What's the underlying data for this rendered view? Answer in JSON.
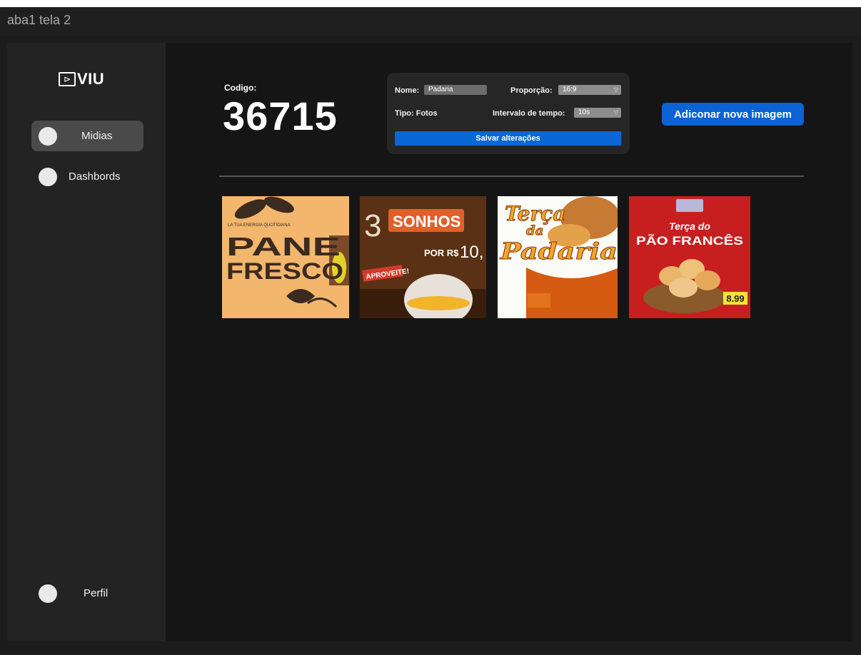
{
  "window": {
    "title": "aba1 tela 2"
  },
  "logo": {
    "glyph": "⊳",
    "text": "VIU"
  },
  "sidebar": {
    "items": [
      {
        "label": "Midias",
        "active": true
      },
      {
        "label": "Dashbords",
        "active": false
      }
    ],
    "profile": {
      "label": "Perfil"
    }
  },
  "main": {
    "code_label": "Codigo:",
    "code_value": "36715",
    "add_button": "Adiconar nova imagem"
  },
  "settings": {
    "name_label": "Nome:",
    "name_value": "Padaria",
    "ratio_label": "Proporção:",
    "ratio_value": "16:9",
    "type_label": "Tipo: Fotos",
    "interval_label": "Intervalo de tempo:",
    "interval_value": "10s",
    "save_button": "Salvar alterações"
  },
  "media": [
    {
      "lines": [
        "LA TUA ENERGIA QUOTIDIANA",
        "PANE",
        "FRESCO"
      ]
    },
    {
      "lines": [
        "3",
        "SONHOS",
        "POR R$",
        "10,",
        "APROVEITE!"
      ]
    },
    {
      "lines": [
        "Terça",
        "da",
        "Padaria"
      ]
    },
    {
      "lines": [
        "Terça do",
        "PÃO FRANCÊS",
        "8.99"
      ]
    }
  ],
  "colors": {
    "accent": "#0b63d4",
    "sidebar": "#232323",
    "background": "#151515"
  }
}
